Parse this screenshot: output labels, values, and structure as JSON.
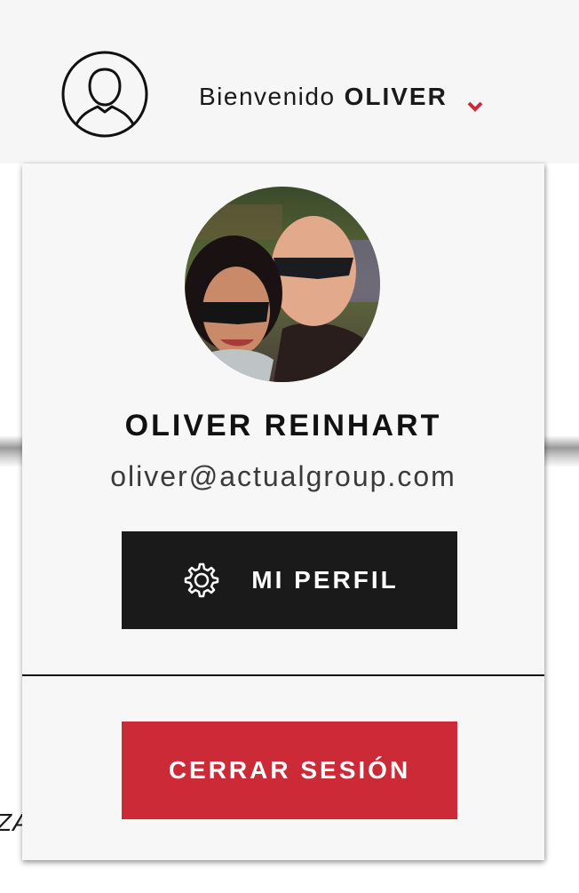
{
  "header": {
    "greeting": "Bienvenido",
    "username": "OLIVER",
    "icons": {
      "user": "user-circle-icon",
      "dropdown": "chevron-down-icon"
    },
    "accent_color": "#cc2a36"
  },
  "background": {
    "fragment_text": "ZA"
  },
  "dropdown": {
    "profile": {
      "full_name": "OLIVER REINHART",
      "email": "oliver@actualgroup.com"
    },
    "profile_button": {
      "label": "MI PERFIL",
      "icon": "gear-icon",
      "color": "#1a1a1a"
    },
    "logout_button": {
      "label": "CERRAR SESIÓN",
      "color": "#cc2a36"
    }
  }
}
